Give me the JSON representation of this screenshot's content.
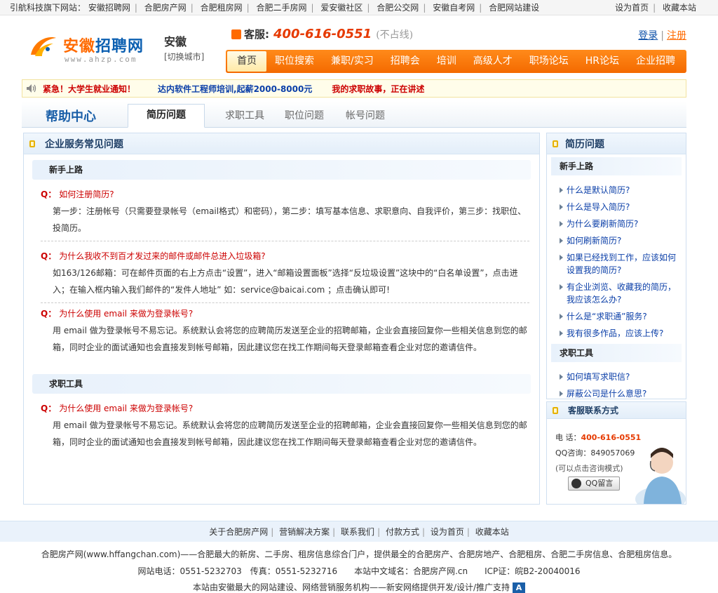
{
  "topbar": {
    "prefix": "引航科技旗下网站：",
    "links": [
      "安徽招聘网",
      "合肥房产网",
      "合肥租房网",
      "合肥二手房网",
      "爱安徽社区",
      "合肥公交网",
      "安徽自考网",
      "合肥网站建设"
    ],
    "right": [
      "设为首页",
      "收藏本站"
    ]
  },
  "header": {
    "logo_text_a": "安徽",
    "logo_text_b": "招聘网",
    "logo_url_text": "www.ahzp.com",
    "city_name": "安徽",
    "city_switch": "[切换城市]",
    "hotline_label": "客服:",
    "hotline_number": "400-616-0551",
    "hotline_note": "(不占线)",
    "login": "登录",
    "register": "注册"
  },
  "nav": [
    "首页",
    "职位搜索",
    "兼职/实习",
    "招聘会",
    "培训",
    "高级人才",
    "职场论坛",
    "HR论坛",
    "企业招聘"
  ],
  "notice": {
    "n1": "紧急！大学生就业通知！",
    "n2": "达内软件工程师培训,起薪2000-8000元",
    "n3": "我的求职故事，正在讲述"
  },
  "help": {
    "title": "帮助中心",
    "tabs": [
      "简历问题",
      "求职工具",
      "职位问题",
      "帐号问题"
    ]
  },
  "main": {
    "title": "企业服务常见问题",
    "sections": [
      {
        "name": "新手上路",
        "items": [
          {
            "q": "如何注册简历?",
            "a": "第一步：注册帐号（只需要登录帐号（email格式）和密码），第二步：填写基本信息、求职意向、自我评价，第三步：找职位、投简历。"
          },
          {
            "q": "为什么我收不到百才发过来的邮件或邮件总进入垃圾箱?",
            "a": "如163/126邮箱：可在邮件页面的右上方点击“设置”，进入“邮箱设置面板”选择“反垃圾设置”这块中的“白名单设置”，点击进入；在输入框内输入我们邮件的“发件人地址” 如：service@baicai.com ；点击确认即可!"
          },
          {
            "q": "为什么使用 email 来做为登录帐号?",
            "a": "用 email 做为登录帐号不易忘记。系统默认会将您的应聘简历发送至企业的招聘邮箱，企业会直接回复你一些相关信息到您的邮箱，同时企业的面试通知也会直接发到帐号邮箱，因此建议您在找工作期间每天登录邮箱查看企业对您的邀请信件。"
          }
        ]
      },
      {
        "name": "求职工具",
        "items": [
          {
            "q": "为什么使用 email 来做为登录帐号?",
            "a": "用 email 做为登录帐号不易忘记。系统默认会将您的应聘简历发送至企业的招聘邮箱，企业会直接回复你一些相关信息到您的邮箱，同时企业的面试通知也会直接发到帐号邮箱，因此建议您在找工作期间每天登录邮箱查看企业对您的邀请信件。"
          }
        ]
      }
    ]
  },
  "side": {
    "title": "简历问题",
    "groups": [
      {
        "name": "新手上路",
        "items": [
          "什么是默认简历?",
          "什么是导入简历?",
          "为什么要刷新简历?",
          "如何刷新简历?",
          "如果已经找到工作，应该如何设置我的简历?",
          "有企业浏览、收藏我的简历，我应该怎么办?",
          "什么是“求职通”服务?",
          "我有很多作品，应该上传?"
        ]
      },
      {
        "name": "求职工具",
        "items": [
          "如何填写求职信?",
          "屏蔽公司是什么意思?"
        ]
      }
    ]
  },
  "service": {
    "title": "客服联系方式",
    "phone_label": "电 话：",
    "phone": "400-616-0551",
    "qq_label": "QQ咨询：",
    "qq": "849057069",
    "hint": "(可以点击咨询模式)",
    "qq_button": "QQ留言"
  },
  "footer": {
    "nav": [
      "关于合肥房产网",
      "营销解决方案",
      "联系我们",
      "付款方式",
      "设为首页",
      "收藏本站"
    ],
    "line1": "合肥房产网(www.hffangchan.com)——合肥最大的新房、二手房、租房信息综合门户，提供最全的合肥房产、合肥房地产、合肥租房、合肥二手房信息、合肥租房信息。",
    "line2": "网站电话：0551-5232703　传真：0551-5232716　　本站中文域名：合肥房产网.cn　　ICP证：皖B2-20040016",
    "line3": "本站由安徽最大的网站建设、网络营销服务机构——新安网络提供开发/设计/推广支持",
    "badge": "A"
  }
}
